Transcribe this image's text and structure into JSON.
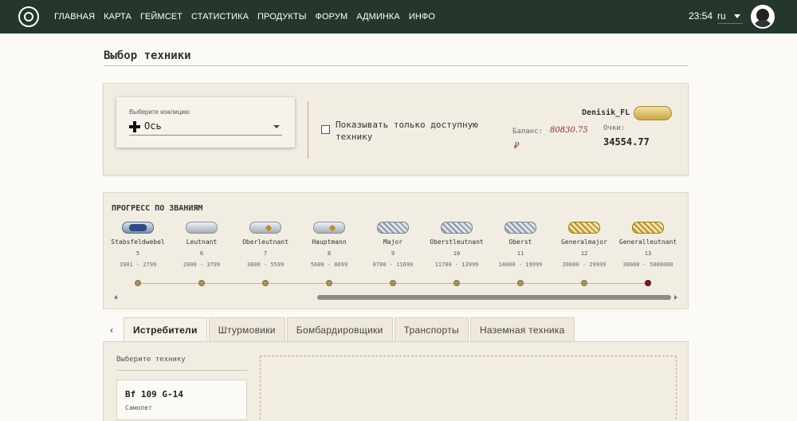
{
  "nav": {
    "items": [
      "ГЛАВНАЯ",
      "КАРТА",
      "ГЕЙМСЕТ",
      "СТАТИСТИКА",
      "ПРОДУКТЫ",
      "ФОРУМ",
      "АДМИНКА",
      "ИНФО"
    ],
    "time": "23:54",
    "lang": "ru"
  },
  "page": {
    "title": "Выбор техники"
  },
  "coalition": {
    "label": "Выберите коалицию",
    "value": "Ось"
  },
  "filter": {
    "label": "Показывать только доступную технику"
  },
  "user": {
    "name": "Denisik_FL",
    "balance_label": "Баланс:",
    "balance_value": "80830.75",
    "currency": "₽",
    "points_label": "Очки:",
    "points_value": "34554.77"
  },
  "progress": {
    "title": "ПРОГРЕСС ПО ЗВАНИЯМ",
    "ranks": [
      {
        "name": "Stabsfeldwebel",
        "level": "5",
        "range": "1901 - 2799",
        "style": "blue"
      },
      {
        "name": "Leutnant",
        "level": "6",
        "range": "2800 - 3799",
        "style": "silver"
      },
      {
        "name": "Oberleutnant",
        "level": "7",
        "range": "3800 - 5599",
        "style": "silver-star"
      },
      {
        "name": "Hauptmann",
        "level": "8",
        "range": "5600 - 8699",
        "style": "silver-star"
      },
      {
        "name": "Major",
        "level": "9",
        "range": "8700 - 11699",
        "style": "braid"
      },
      {
        "name": "Oberstleutnant",
        "level": "10",
        "range": "11700 - 13999",
        "style": "braid"
      },
      {
        "name": "Oberst",
        "level": "11",
        "range": "14000 - 19999",
        "style": "braid"
      },
      {
        "name": "Generalmajor",
        "level": "12",
        "range": "20000 - 29999",
        "style": "gold"
      },
      {
        "name": "Generalleutnant",
        "level": "13",
        "range": "30000 - 5000000",
        "style": "gold"
      }
    ],
    "current_index": 8
  },
  "tabs": [
    "Истребители",
    "Штурмовики",
    "Бомбардировщики",
    "Транспорты",
    "Наземная техника"
  ],
  "active_tab": 0,
  "vehicles": {
    "label": "Выберите технику",
    "items": [
      {
        "name": "Bf 109 G-14",
        "type": "Самолет"
      }
    ]
  }
}
